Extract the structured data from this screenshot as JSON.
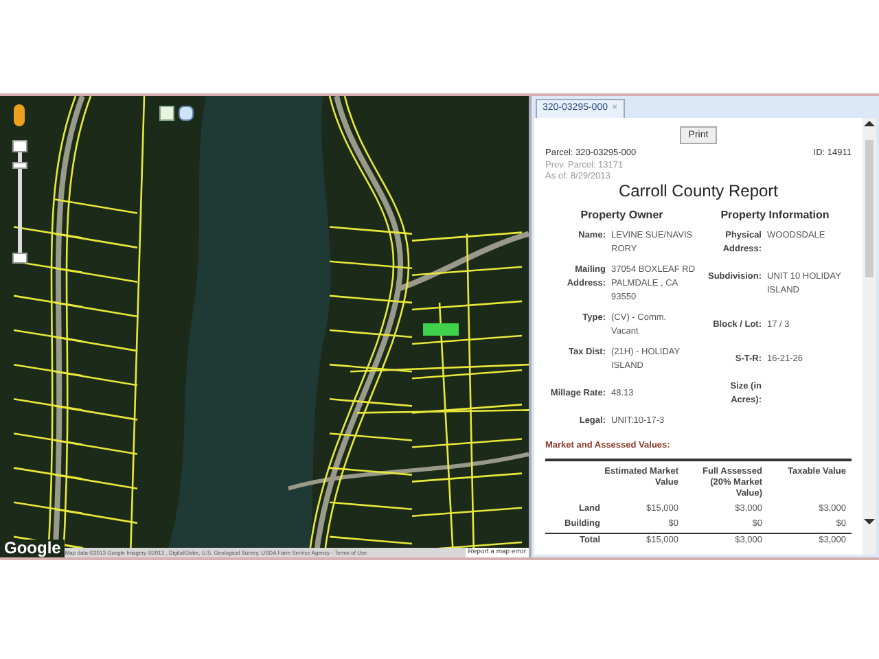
{
  "map": {
    "zoom": {
      "level": 0.8
    },
    "logo": "Google",
    "attribution": "Map data ©2013 Google Imagery ©2013 , DigitalGlobe, U.S. Geological Survey, USDA Farm Service Agency - Terms of Use",
    "report_link": "Report a map error"
  },
  "panel": {
    "tab": {
      "label": "320-03295-000",
      "close": "×",
      "selected": true
    },
    "print_button": "Print",
    "parcel": "Parcel: 320-03295-000",
    "id": "ID: 14911",
    "prev_parcel": "Prev. Parcel: 13171",
    "as_of": "As of: 8/29/2013",
    "title": "Carroll County Report",
    "headings": [
      "Property Owner",
      "Property Information"
    ],
    "rows": [
      {
        "left": {
          "label": "Name:",
          "value": "LEVINE SUE/NAVIS RORY"
        },
        "right": {
          "label": "Physical Address:",
          "value": "WOODSDALE"
        }
      },
      {
        "left": {
          "label": "Mailing Address:",
          "value": "37054 BOXLEAF RD PALMDALE , CA 93550"
        },
        "right": {
          "label": "Subdivision:",
          "value": "UNIT 10 HOLIDAY ISLAND"
        }
      },
      {
        "left": {
          "label": "Type:",
          "value": "(CV) - Comm. Vacant"
        },
        "right": {
          "label": "Block / Lot:",
          "value": "17 / 3"
        }
      },
      {
        "left": {
          "label": "Tax Dist:",
          "value": "(21H) - HOLIDAY ISLAND"
        },
        "right": {
          "label": "S-T-R:",
          "value": "16-21-26"
        }
      },
      {
        "left": {
          "label": "Millage Rate:",
          "value": "48.13"
        },
        "right": {
          "label": "Size (in Acres):"
        }
      },
      {
        "left": {
          "label": "Legal:",
          "value": "UNIT:10-17-3"
        }
      }
    ],
    "section": "Market and Assessed Values:",
    "values_table": {
      "columns": [
        "Estimated Market Value",
        "Full Assessed (20% Market Value)",
        "Taxable Value"
      ],
      "rows": [
        {
          "label": "Land",
          "cells": [
            "$15,000",
            "$3,000",
            "$3,000"
          ]
        },
        {
          "label": "Building",
          "cells": [
            "$0",
            "$0",
            "$0"
          ]
        },
        {
          "label": "Total",
          "cells": [
            "$15,000",
            "$3,000",
            "$3,000"
          ]
        }
      ]
    }
  }
}
